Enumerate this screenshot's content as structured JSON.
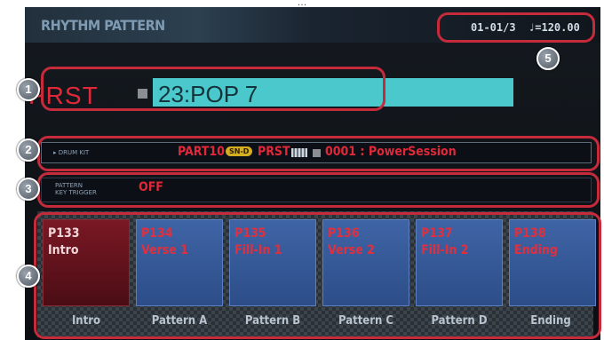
{
  "caption": "[top of page text partially cut off]",
  "header": {
    "title": "RHYTHM PATTERN",
    "position": "01-01/3",
    "tempo": "♩=120.00"
  },
  "pattern": {
    "group": "PRST",
    "name": "23:POP 7"
  },
  "drum_kit": {
    "label": "DRUM KIT",
    "part": "PART10",
    "badge": "SN-D",
    "group": "PRST",
    "value": "0001 : PowerSession"
  },
  "trigger": {
    "label_line1": "PATTERN",
    "label_line2": "KEY TRIGGER",
    "value": "OFF"
  },
  "pads": [
    {
      "num": "P133",
      "name": "Intro",
      "slot": "Intro"
    },
    {
      "num": "P134",
      "name": "Verse 1",
      "slot": "Pattern A"
    },
    {
      "num": "P135",
      "name": "Fill-In 1",
      "slot": "Pattern B"
    },
    {
      "num": "P136",
      "name": "Verse 2",
      "slot": "Pattern C"
    },
    {
      "num": "P137",
      "name": "Fill-In 2",
      "slot": "Pattern D"
    },
    {
      "num": "P138",
      "name": "Ending",
      "slot": "Ending"
    }
  ],
  "callouts": [
    "1",
    "2",
    "3",
    "4",
    "5"
  ],
  "colors": {
    "highlight": "#c62b3c",
    "accent_red": "#e02838",
    "name_bar": "#4bc8cc",
    "pad_blue": "#3f64a6",
    "pad_active": "#7a1824"
  }
}
